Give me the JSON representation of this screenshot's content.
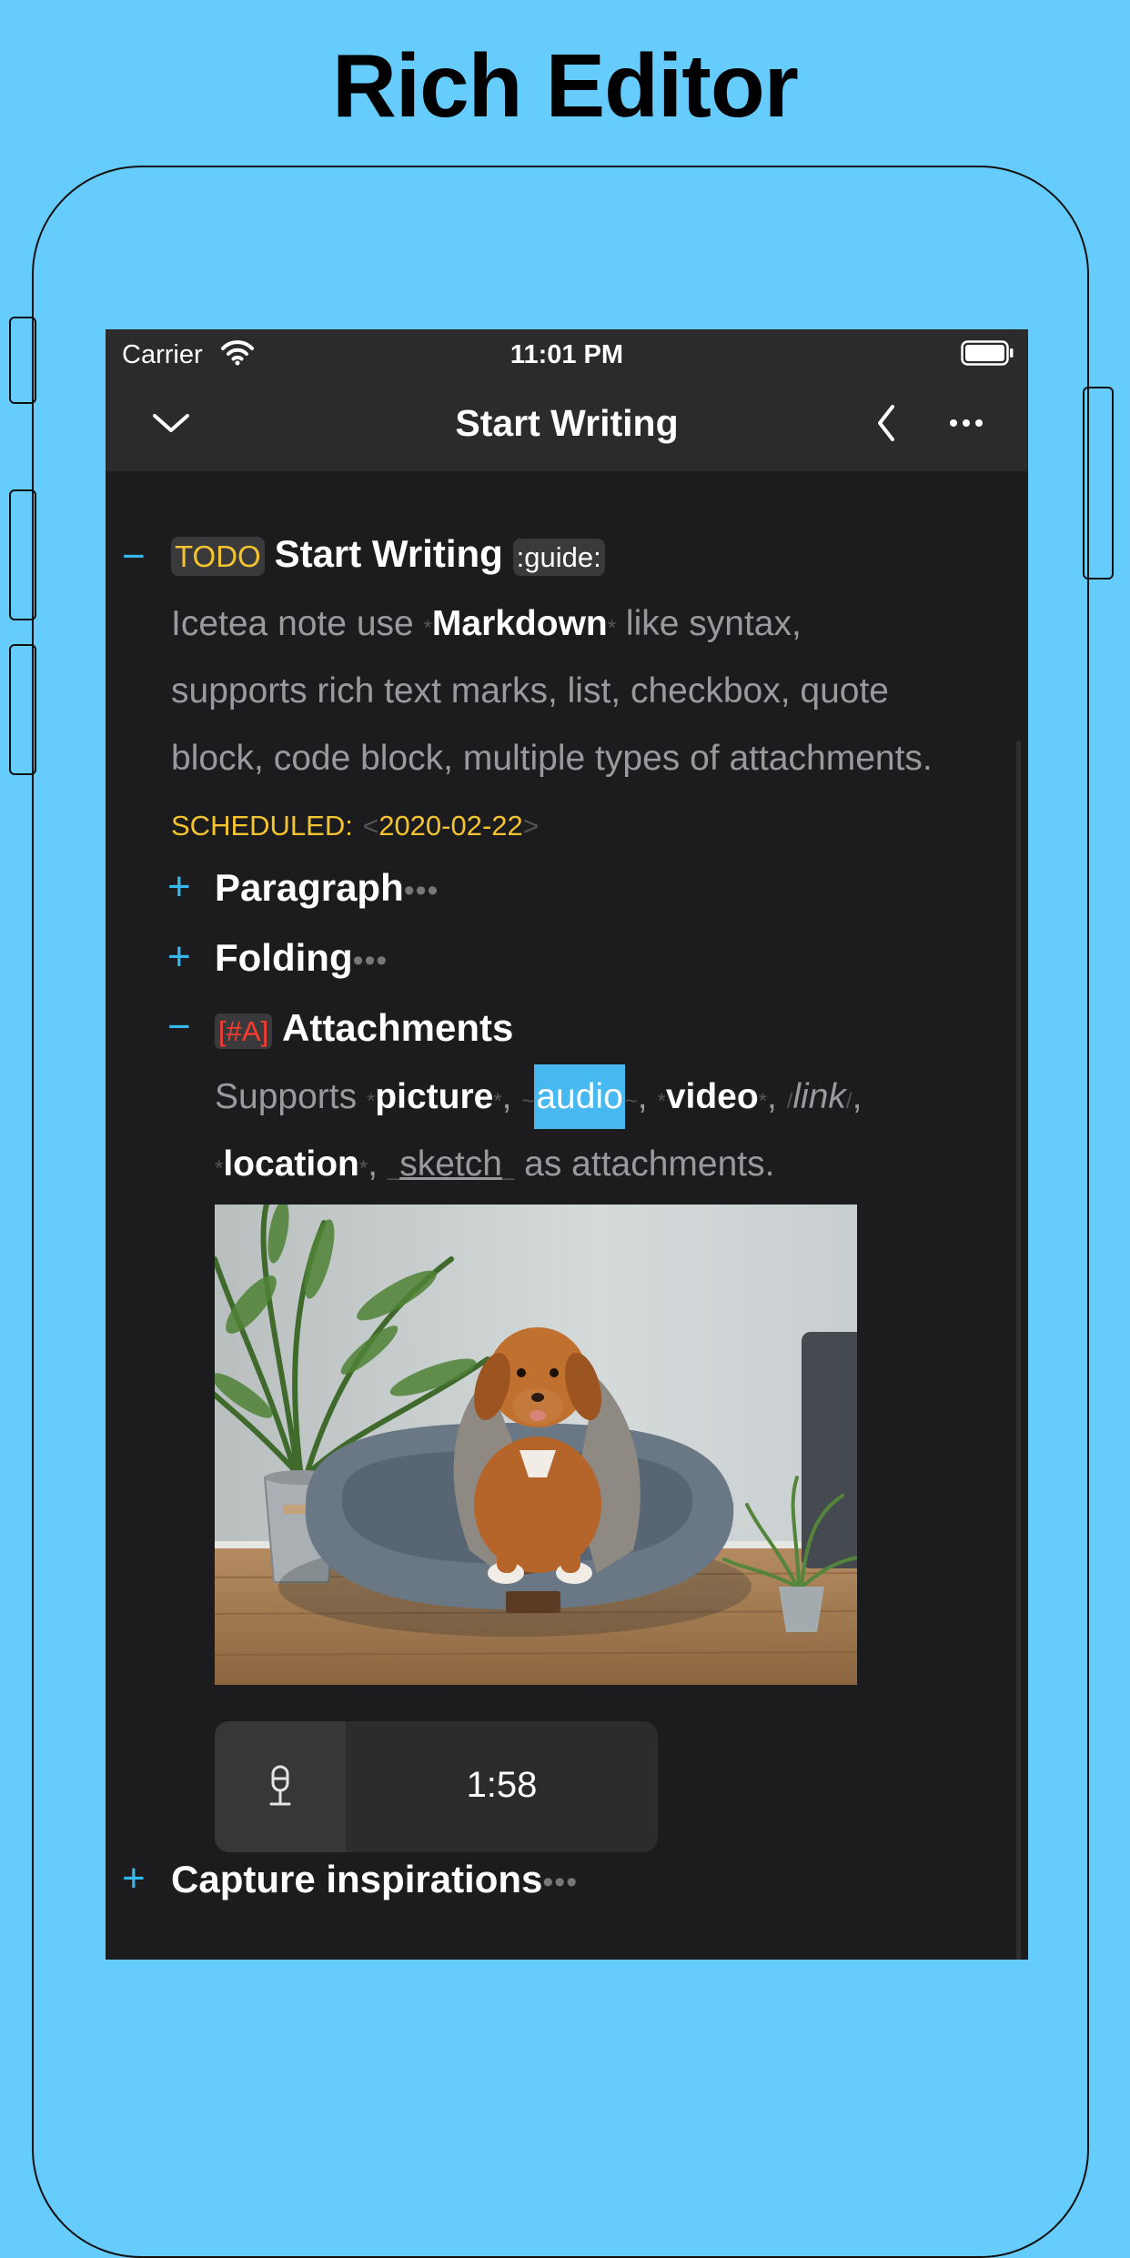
{
  "headline": "Rich Editor",
  "status_bar": {
    "carrier": "Carrier",
    "time": "11:01 PM"
  },
  "navbar": {
    "title": "Start Writing"
  },
  "doc": {
    "root": {
      "toggle": "−",
      "todo": "TODO",
      "title": "Start Writing",
      "tag": ":guide:",
      "body_lines": [
        {
          "pre": "Icetea note use ",
          "m1": "*",
          "bold": "Markdown",
          "m2": "*",
          "post": " like syntax,"
        },
        "supports rich text marks, list, checkbox, quote",
        "block, code block, multiple types of attachments."
      ],
      "scheduled_label": "SCHEDULED:",
      "scheduled_open": "<",
      "scheduled_date": "2020-02-22",
      "scheduled_close": ">"
    },
    "sections": [
      {
        "toggle": "+",
        "title": "Paragraph",
        "dots": "•••"
      },
      {
        "toggle": "+",
        "title": "Folding",
        "dots": "•••"
      },
      {
        "toggle": "−",
        "priority": "[#A]",
        "title": "Attachments"
      }
    ],
    "attachments_text": {
      "supports": "Supports ",
      "m_star": "*",
      "picture": "picture",
      "comma": ", ",
      "m_tilde": "~",
      "audio": "audio",
      "video": "video",
      "m_slash": "/",
      "link": "link",
      "trail_comma": ",",
      "location": "location",
      "m_under": "_",
      "sketch": "sketch",
      "tail": " as attachments."
    },
    "audio_player": {
      "time": "1:58"
    },
    "last_section": {
      "toggle": "+",
      "title": "Capture inspirations",
      "dots": "•••"
    }
  },
  "colors": {
    "background": "#66ccfc",
    "screen": "#1c1c1e",
    "bar": "#2b2b2d",
    "accent": "#35b8ee",
    "todo": "#f4c430",
    "priority": "#ff3b30"
  },
  "icons": [
    "wifi-icon",
    "battery-icon",
    "chevron-down-icon",
    "chevron-left-icon",
    "more-icon",
    "microphone-icon"
  ]
}
